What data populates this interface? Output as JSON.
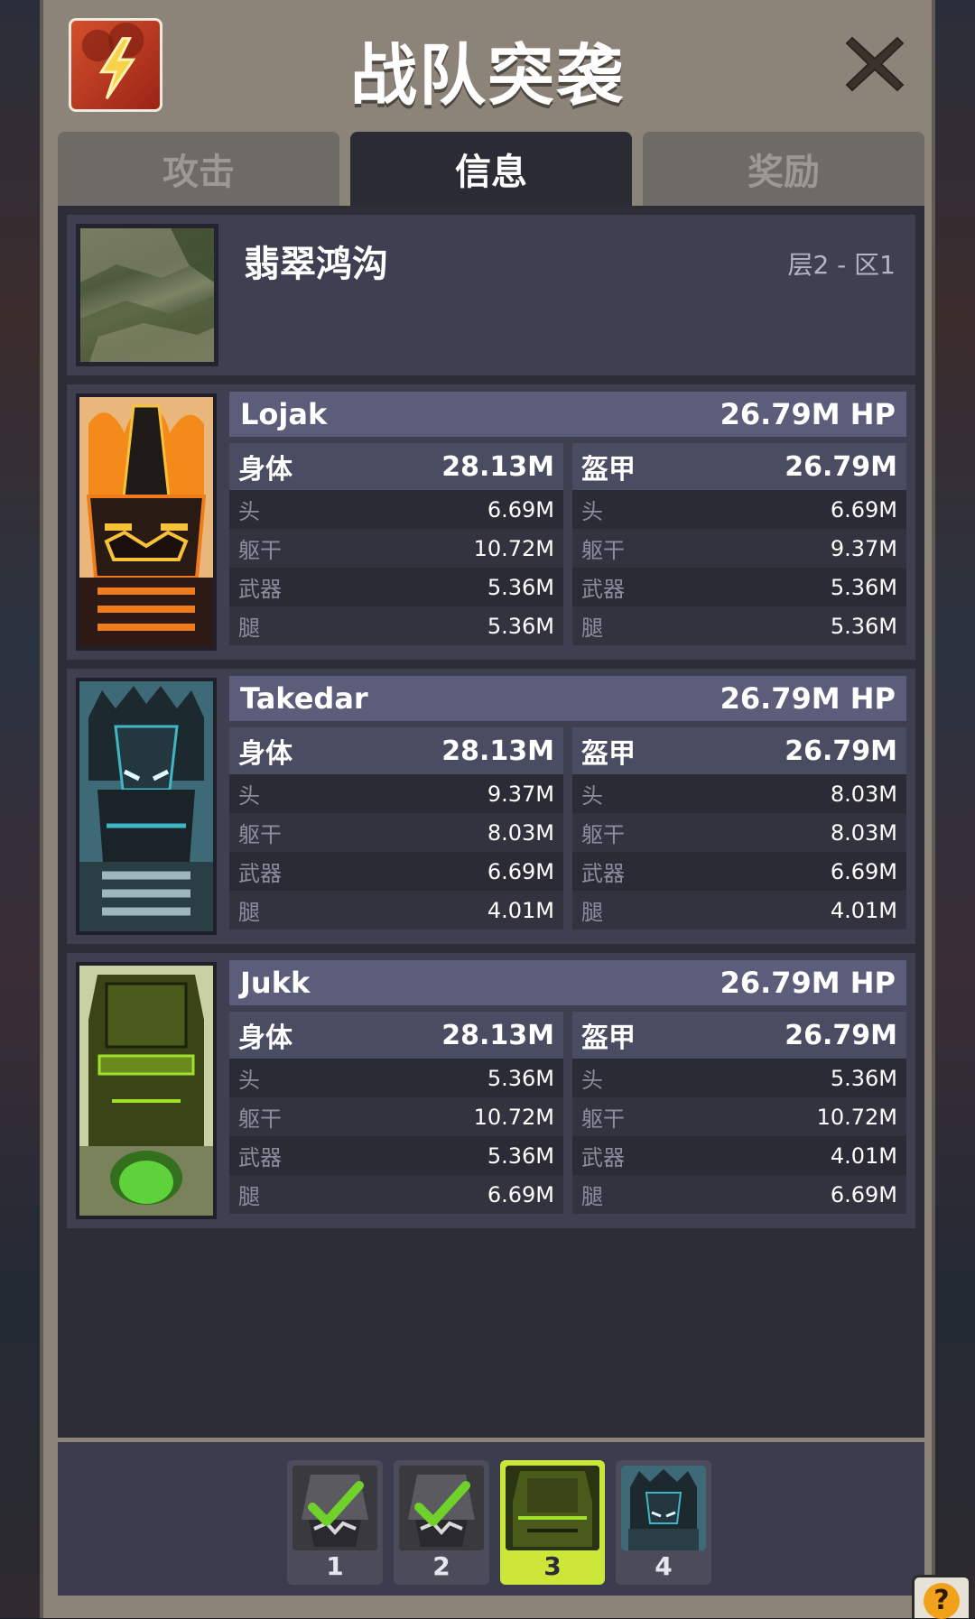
{
  "title": "战队突袭",
  "tabs": [
    {
      "label": "攻击",
      "active": false
    },
    {
      "label": "信息",
      "active": true
    },
    {
      "label": "奖励",
      "active": false
    }
  ],
  "zone": {
    "name": "翡翠鸿沟",
    "location": "层2 - 区1"
  },
  "bosses": [
    {
      "name": "Lojak",
      "hp": "26.79M HP",
      "body": {
        "label": "身体",
        "value": "28.13M",
        "parts": [
          {
            "label": "头",
            "value": "6.69M"
          },
          {
            "label": "躯干",
            "value": "10.72M"
          },
          {
            "label": "武器",
            "value": "5.36M"
          },
          {
            "label": "腿",
            "value": "5.36M"
          }
        ]
      },
      "armor": {
        "label": "盔甲",
        "value": "26.79M",
        "parts": [
          {
            "label": "头",
            "value": "6.69M"
          },
          {
            "label": "躯干",
            "value": "9.37M"
          },
          {
            "label": "武器",
            "value": "5.36M"
          },
          {
            "label": "腿",
            "value": "5.36M"
          }
        ]
      }
    },
    {
      "name": "Takedar",
      "hp": "26.79M HP",
      "body": {
        "label": "身体",
        "value": "28.13M",
        "parts": [
          {
            "label": "头",
            "value": "9.37M"
          },
          {
            "label": "躯干",
            "value": "8.03M"
          },
          {
            "label": "武器",
            "value": "6.69M"
          },
          {
            "label": "腿",
            "value": "4.01M"
          }
        ]
      },
      "armor": {
        "label": "盔甲",
        "value": "26.79M",
        "parts": [
          {
            "label": "头",
            "value": "8.03M"
          },
          {
            "label": "躯干",
            "value": "8.03M"
          },
          {
            "label": "武器",
            "value": "6.69M"
          },
          {
            "label": "腿",
            "value": "4.01M"
          }
        ]
      }
    },
    {
      "name": "Jukk",
      "hp": "26.79M HP",
      "body": {
        "label": "身体",
        "value": "28.13M",
        "parts": [
          {
            "label": "头",
            "value": "5.36M"
          },
          {
            "label": "躯干",
            "value": "10.72M"
          },
          {
            "label": "武器",
            "value": "5.36M"
          },
          {
            "label": "腿",
            "value": "6.69M"
          }
        ]
      },
      "armor": {
        "label": "盔甲",
        "value": "26.79M",
        "parts": [
          {
            "label": "头",
            "value": "5.36M"
          },
          {
            "label": "躯干",
            "value": "10.72M"
          },
          {
            "label": "武器",
            "value": "4.01M"
          },
          {
            "label": "腿",
            "value": "6.69M"
          }
        ]
      }
    }
  ],
  "slots": [
    {
      "label": "1",
      "completed": true,
      "selected": false
    },
    {
      "label": "2",
      "completed": true,
      "selected": false
    },
    {
      "label": "3",
      "completed": false,
      "selected": true
    },
    {
      "label": "4",
      "completed": false,
      "selected": false
    }
  ],
  "help_label": "?",
  "colors": {
    "accent_selected": "#cde63a",
    "name_bar": "#5b5d7a",
    "check": "#6fd12a"
  }
}
